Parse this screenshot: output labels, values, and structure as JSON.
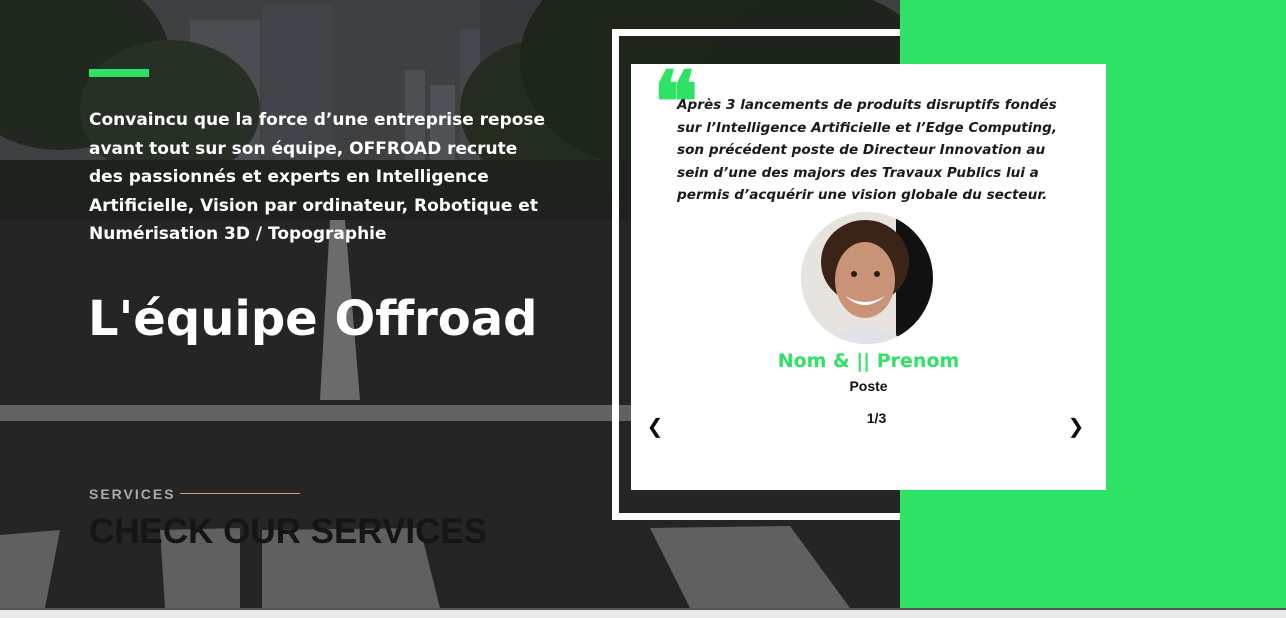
{
  "hero": {
    "intro_text": "Convaincu que la force d’une entreprise repose avant tout sur son équipe, OFFROAD recrute des passionnés et experts en Intelligence Artificielle, Vision par ordinateur, Robotique et Numérisation 3D / Topographie",
    "team_title": "L'équipe Offroad"
  },
  "services": {
    "label": "SERVICES",
    "title": "CHECK OUR SERVICES"
  },
  "testimonial": {
    "quote_icon": "quote-open-icon",
    "quote": "Après 3 lancements de produits disruptifs fondés sur l’Intelligence Artificielle et l’Edge Computing, son précédent poste de Directeur Innovation au sein d’une des majors des Travaux Publics lui a permis d’acquérir une vision globale du secteur.",
    "name": "Nom & || Prenom",
    "role": "Poste",
    "pager": "1/3",
    "prev": "❮",
    "next": "❯"
  },
  "colors": {
    "accent": "#2ee265",
    "services_line": "#c8a66d"
  }
}
